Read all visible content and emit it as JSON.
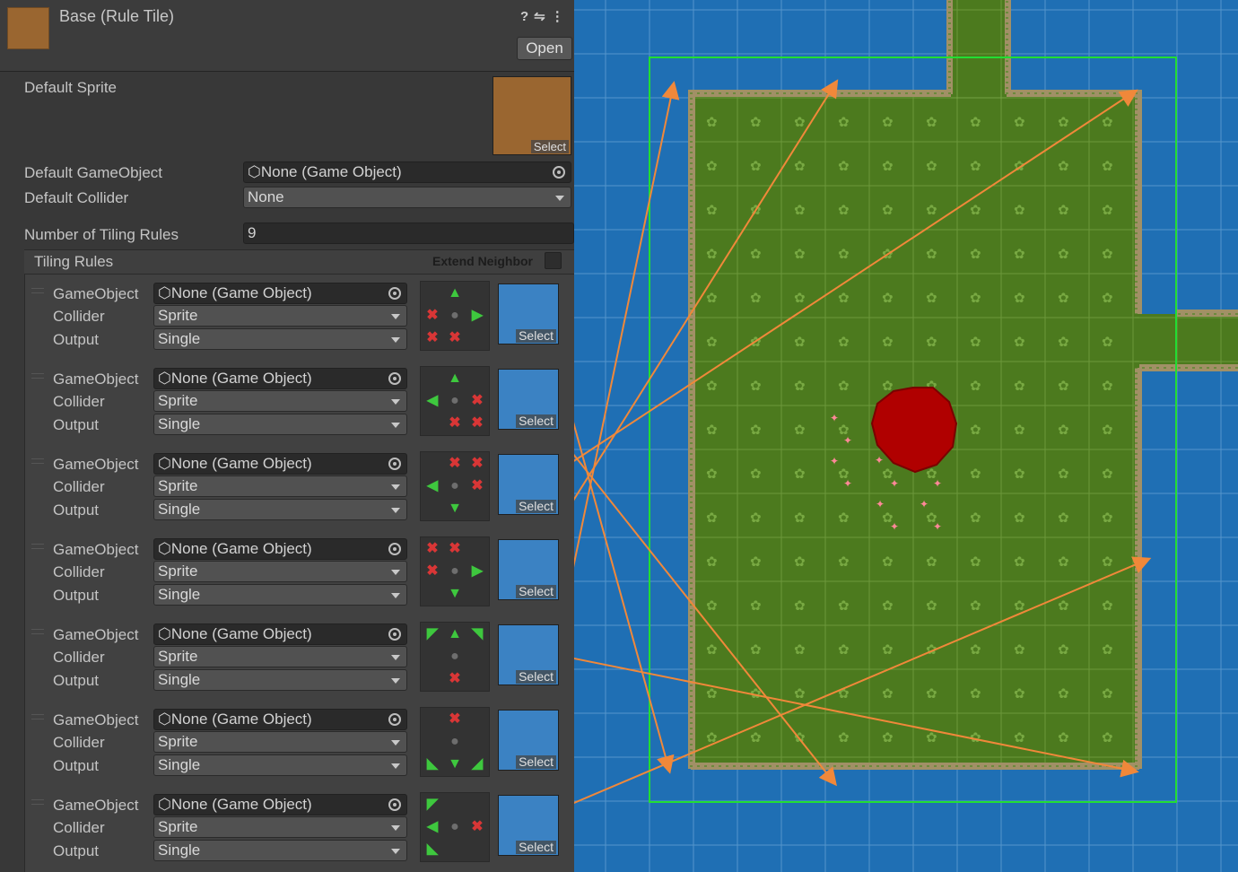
{
  "header": {
    "title": "Base (Rule Tile)",
    "icons": [
      "help-icon",
      "preset-icon",
      "more-icon"
    ],
    "open_label": "Open"
  },
  "default_sprite": {
    "label": "Default Sprite",
    "select_label": "Select",
    "color": "#9a6630"
  },
  "default_gameobject": {
    "label": "Default GameObject",
    "value": "None (Game Object)"
  },
  "default_collider": {
    "label": "Default Collider",
    "value": "None"
  },
  "tiling_rules_count": {
    "label": "Number of Tiling Rules",
    "value": "9"
  },
  "tiling_rules": {
    "title": "Tiling Rules",
    "extend_neighbor_label": "Extend Neighbor"
  },
  "rule_labels": {
    "gameobject": "GameObject",
    "collider": "Collider",
    "output": "Output",
    "select": "Select"
  },
  "rules": [
    {
      "gameobject": "None (Game Object)",
      "collider": "Sprite",
      "output": "Single",
      "neighbors": [
        "",
        "up",
        "",
        "x",
        "",
        "right",
        "x",
        "x",
        ""
      ]
    },
    {
      "gameobject": "None (Game Object)",
      "collider": "Sprite",
      "output": "Single",
      "neighbors": [
        "",
        "up",
        "",
        "left",
        "",
        "x",
        "",
        "x",
        "x"
      ]
    },
    {
      "gameobject": "None (Game Object)",
      "collider": "Sprite",
      "output": "Single",
      "neighbors": [
        "",
        "x",
        "x",
        "left",
        "",
        "x",
        "",
        "down",
        ""
      ]
    },
    {
      "gameobject": "None (Game Object)",
      "collider": "Sprite",
      "output": "Single",
      "neighbors": [
        "x",
        "x",
        "",
        "x",
        "",
        "right",
        "",
        "down",
        ""
      ]
    },
    {
      "gameobject": "None (Game Object)",
      "collider": "Sprite",
      "output": "Single",
      "neighbors": [
        "up-left",
        "up",
        "up-right",
        "",
        "",
        "",
        "",
        "x",
        ""
      ]
    },
    {
      "gameobject": "None (Game Object)",
      "collider": "Sprite",
      "output": "Single",
      "neighbors": [
        "",
        "x",
        "",
        "",
        "",
        "",
        "down-left",
        "down",
        "down-right"
      ]
    },
    {
      "gameobject": "None (Game Object)",
      "collider": "Sprite",
      "output": "Single",
      "neighbors": [
        "up-left",
        "",
        "",
        "left",
        "",
        "x",
        "down-left",
        "",
        ""
      ]
    }
  ],
  "colors": {
    "water": "#1f6fb4",
    "grass": "#4c7a1e",
    "selection_outline": "#22dd33",
    "arrow": "#f0883a",
    "ball": "#b00000",
    "panel": "#383838"
  }
}
